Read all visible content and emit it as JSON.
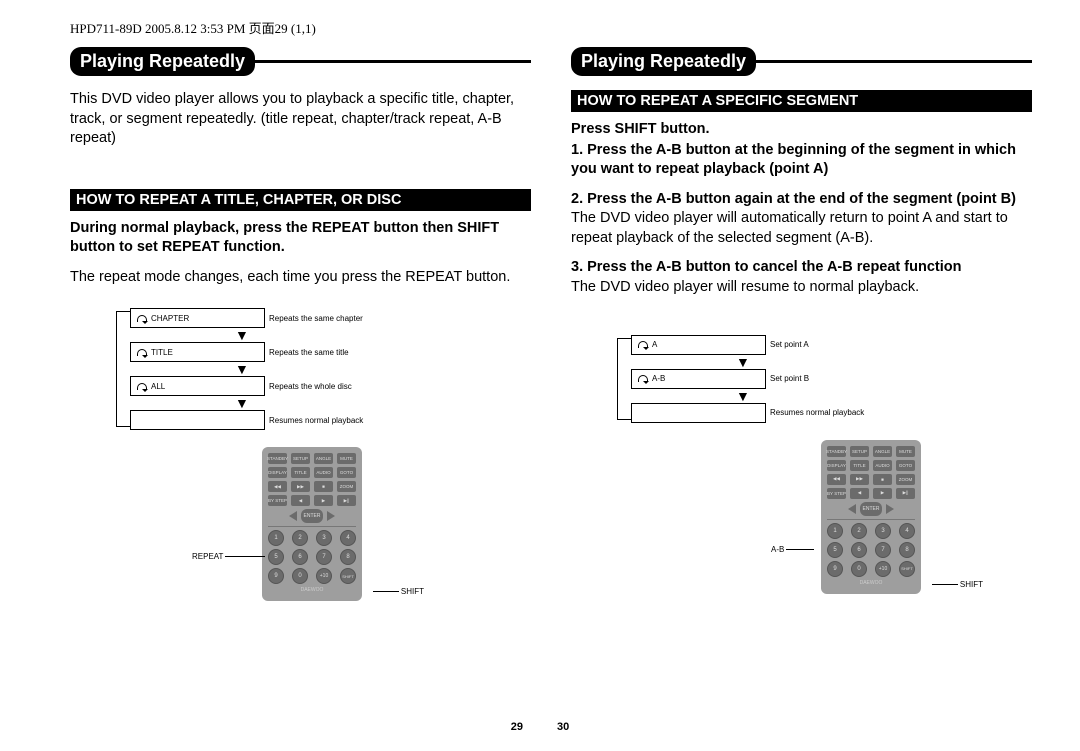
{
  "doc_header": "HPD711-89D  2005.8.12  3:53 PM  页面29 (1,1)",
  "left": {
    "title": "Playing Repeatedly",
    "intro": "This DVD video player allows you to playback a specific title, chapter, track, or segment repeatedly. (title repeat, chapter/track repeat, A-B repeat)",
    "subhead": "HOW TO REPEAT A TITLE, CHAPTER, OR DISC",
    "instr_bold": "During normal playback, press the REPEAT button then SHIFT button to set REPEAT function.",
    "instr_body": "The repeat mode changes, each time you press the REPEAT button.",
    "flow": [
      {
        "tag": "CHAPTER",
        "desc": "Repeats the same chapter"
      },
      {
        "tag": "TITLE",
        "desc": "Repeats the same title"
      },
      {
        "tag": "ALL",
        "desc": "Repeats the whole disc"
      },
      {
        "tag": "",
        "desc": "Resumes normal playback"
      }
    ],
    "remote_labels": {
      "left": "REPEAT",
      "right": "SHIFT"
    }
  },
  "right": {
    "title": "Playing Repeatedly",
    "subhead": "HOW TO REPEAT A SPECIFIC SEGMENT",
    "p1": "Press SHIFT button.",
    "p2": "1. Press the A-B button at the beginning of the segment in which you want to repeat playback (point A)",
    "p3": "2. Press the A-B button again at the end of the segment (point B)",
    "p3b": "The DVD video player will automatically return to point A and start to repeat playback of the selected segment (A-B).",
    "p4": "3. Press the A-B button to cancel the A-B repeat function",
    "p4b": "The DVD video player will resume to normal playback.",
    "flow": [
      {
        "tag": "A",
        "desc": "Set point A"
      },
      {
        "tag": "A-B",
        "desc": "Set point B"
      },
      {
        "tag": "",
        "desc": "Resumes normal playback"
      }
    ],
    "remote_labels": {
      "left": "A-B",
      "right": "SHIFT"
    }
  },
  "remote": {
    "row1": [
      "STANDBY",
      "SETUP",
      "ANGLE",
      "MUTE"
    ],
    "row2": [
      "DISPLAY",
      "TITLE",
      "AUDIO",
      "GOTO"
    ],
    "row3": [
      "◀◀",
      "▶▶",
      "■",
      "ZOOM"
    ],
    "row4": [
      "BY STEP",
      "◀",
      "▶",
      "▶||"
    ],
    "enter": "ENTER",
    "nums": [
      "1",
      "2",
      "3",
      "4",
      "5",
      "6",
      "7",
      "8",
      "9",
      "0",
      "+10",
      "SHIFT"
    ],
    "brand": "DAEWOO"
  },
  "pages": {
    "left": "29",
    "right": "30"
  }
}
